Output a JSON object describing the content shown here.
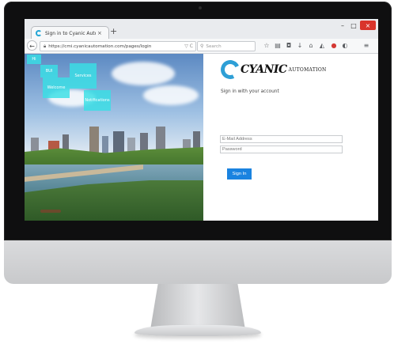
{
  "browser": {
    "tab_title": "Sign in to Cyanic Automati...",
    "tab_close": "×",
    "new_tab": "+",
    "url": "https://cmi.cyanicautomation.com/pages/login",
    "url_tools": "▽ C",
    "search_placeholder": "Search",
    "window": {
      "minimize": "–",
      "maximize": "□",
      "close": "×"
    }
  },
  "tiles": [
    "Hi",
    "BUI",
    "Services",
    "Welcome",
    "Notifications"
  ],
  "login": {
    "brand": "CYANIC",
    "brand_sub": "AUTOMATION",
    "prompt": "Sign in with your account",
    "email_placeholder": "E-Mail Address",
    "password_placeholder": "Password",
    "signin_button": "Sign In"
  },
  "colors": {
    "accent": "#1a83e0",
    "tile": "#38dfe5",
    "close": "#d9342b"
  }
}
